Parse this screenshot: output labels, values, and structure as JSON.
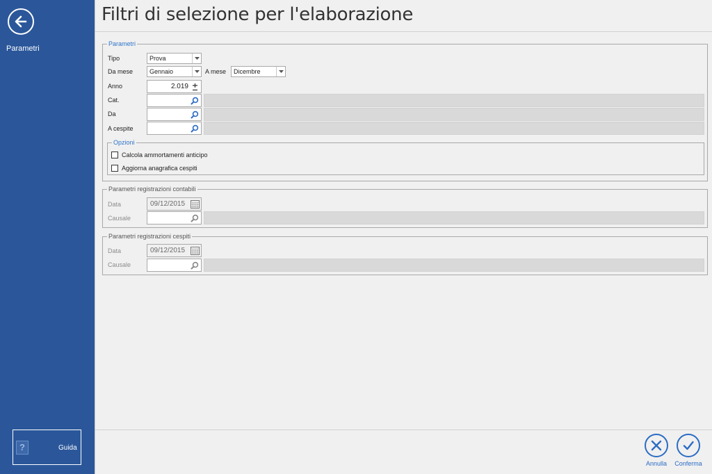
{
  "sidebar": {
    "title": "Parametri",
    "help_button_label": "Guida",
    "help_icon_glyph": "?"
  },
  "page": {
    "title": "Filtri di selezione per l'elaborazione"
  },
  "parametri": {
    "legend": "Parametri",
    "tipo": {
      "label": "Tipo",
      "value": "Prova"
    },
    "da_mese": {
      "label": "Da mese",
      "value": "Gennaio"
    },
    "a_mese": {
      "label": "A mese",
      "value": "Dicembre"
    },
    "anno": {
      "label": "Anno",
      "value": "2.019"
    },
    "cat": {
      "label": "Cat.",
      "value": "",
      "description": ""
    },
    "da": {
      "label": "Da",
      "value": "",
      "description": ""
    },
    "a_cespite": {
      "label": "A cespite",
      "value": "",
      "description": ""
    },
    "opzioni": {
      "legend": "Opzioni",
      "calcola_label": "Calcola ammortamenti anticipo",
      "calcola_checked": false,
      "aggiorna_label": "Aggiorna anagrafica cespiti",
      "aggiorna_checked": false
    }
  },
  "reg_contabili": {
    "legend": "Parametri registrazioni contabili",
    "data_label": "Data",
    "data_value": "09/12/2015",
    "causale_label": "Causale",
    "causale_value": ""
  },
  "reg_cespiti": {
    "legend": "Parametri registrazioni cespiti",
    "data_label": "Data",
    "data_value": "09/12/2015",
    "causale_label": "Causale",
    "causale_value": ""
  },
  "actions": {
    "annulla": "Annulla",
    "conferma": "Conferma"
  },
  "colors": {
    "sidebar": "#2b579a",
    "accent": "#2b6cc4",
    "legend_blue": "#2e74c8"
  },
  "icons": [
    "back-arrow-icon",
    "help-icon",
    "dropdown-arrow-icon",
    "spin-icon",
    "search-icon",
    "calendar-icon",
    "cancel-icon",
    "confirm-icon"
  ]
}
